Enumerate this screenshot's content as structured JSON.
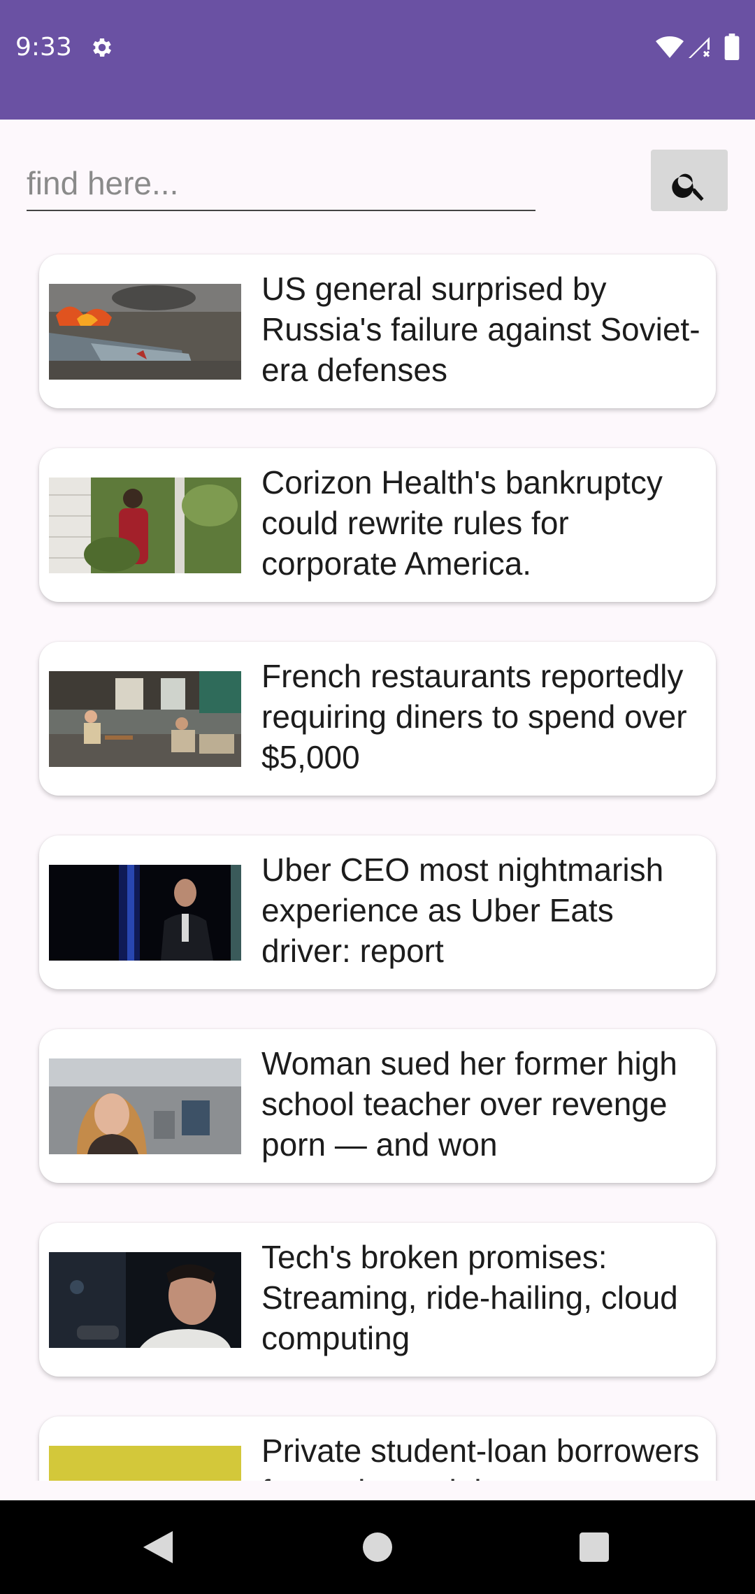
{
  "status_bar": {
    "time": "9:33",
    "icons": [
      "gear-icon",
      "wifi-icon",
      "signal-icon",
      "battery-icon"
    ],
    "background": "#6a51a3"
  },
  "search": {
    "placeholder": "find here...",
    "value": "",
    "button_icon": "search-icon"
  },
  "articles": [
    {
      "title": "US general surprised by Russia's failure against Soviet-era defenses",
      "image": "crashed-aircraft-fire"
    },
    {
      "title": "Corizon Health's bankruptcy could rewrite rules for corporate America.",
      "image": "man-in-red-shirt-garden"
    },
    {
      "title": "French restaurants reportedly requiring diners to spend over $5,000",
      "image": "outdoor-cafe-terrace"
    },
    {
      "title": "Uber CEO most nightmarish experience as Uber Eats driver: report",
      "image": "speaker-on-dark-stage"
    },
    {
      "title": "Woman sued her former high school teacher over revenge porn — and won",
      "image": "woman-city-panorama"
    },
    {
      "title": "Tech's broken promises: Streaming, ride-hailing, cloud computing",
      "image": "man-profile-dark"
    },
    {
      "title": "Private student-loan borrowers face a huge debt",
      "image": "yellow-block"
    }
  ],
  "nav_bar": {
    "icons": [
      "back-icon",
      "home-icon",
      "recents-icon"
    ]
  }
}
